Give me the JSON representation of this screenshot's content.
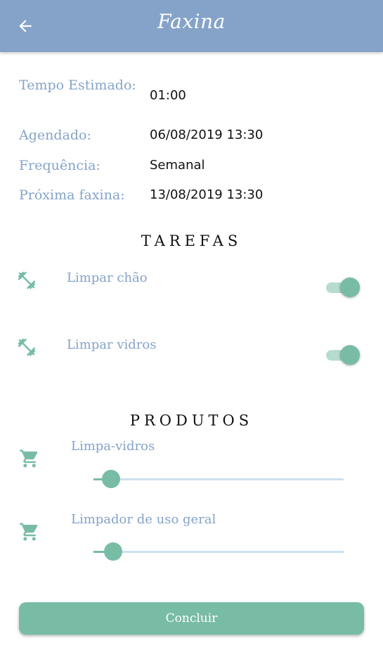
{
  "header": {
    "title": "Faxina",
    "back_icon": "arrow-back-icon"
  },
  "info": [
    {
      "label": "Tempo Estimado:",
      "value": "01:00"
    },
    {
      "label": "Agendado:",
      "value": "06/08/2019 13:30"
    },
    {
      "label": "Frequência:",
      "value": "Semanal"
    },
    {
      "label": "Próxima faxina:",
      "value": "13/08/2019 13:30"
    }
  ],
  "tasks": {
    "title": "TAREFAS",
    "items": [
      {
        "label": "Limpar chão",
        "icon": "dumbbell-icon",
        "enabled": true
      },
      {
        "label": "Limpar vidros",
        "icon": "dumbbell-icon",
        "enabled": true
      }
    ]
  },
  "products": {
    "title": "PRODUTOS",
    "items": [
      {
        "label": "Limpa-vidros",
        "icon": "cart-icon",
        "level": 0.07
      },
      {
        "label": "Limpador de uso geral",
        "icon": "cart-icon",
        "level": 0.08
      }
    ]
  },
  "footer": {
    "button_label": "Concluir"
  },
  "colors": {
    "primary": "#85a3c8",
    "accent": "#78bca6",
    "accent_light": "#b7dbcf",
    "slider_track": "#cde0ef",
    "text": "#111111"
  }
}
